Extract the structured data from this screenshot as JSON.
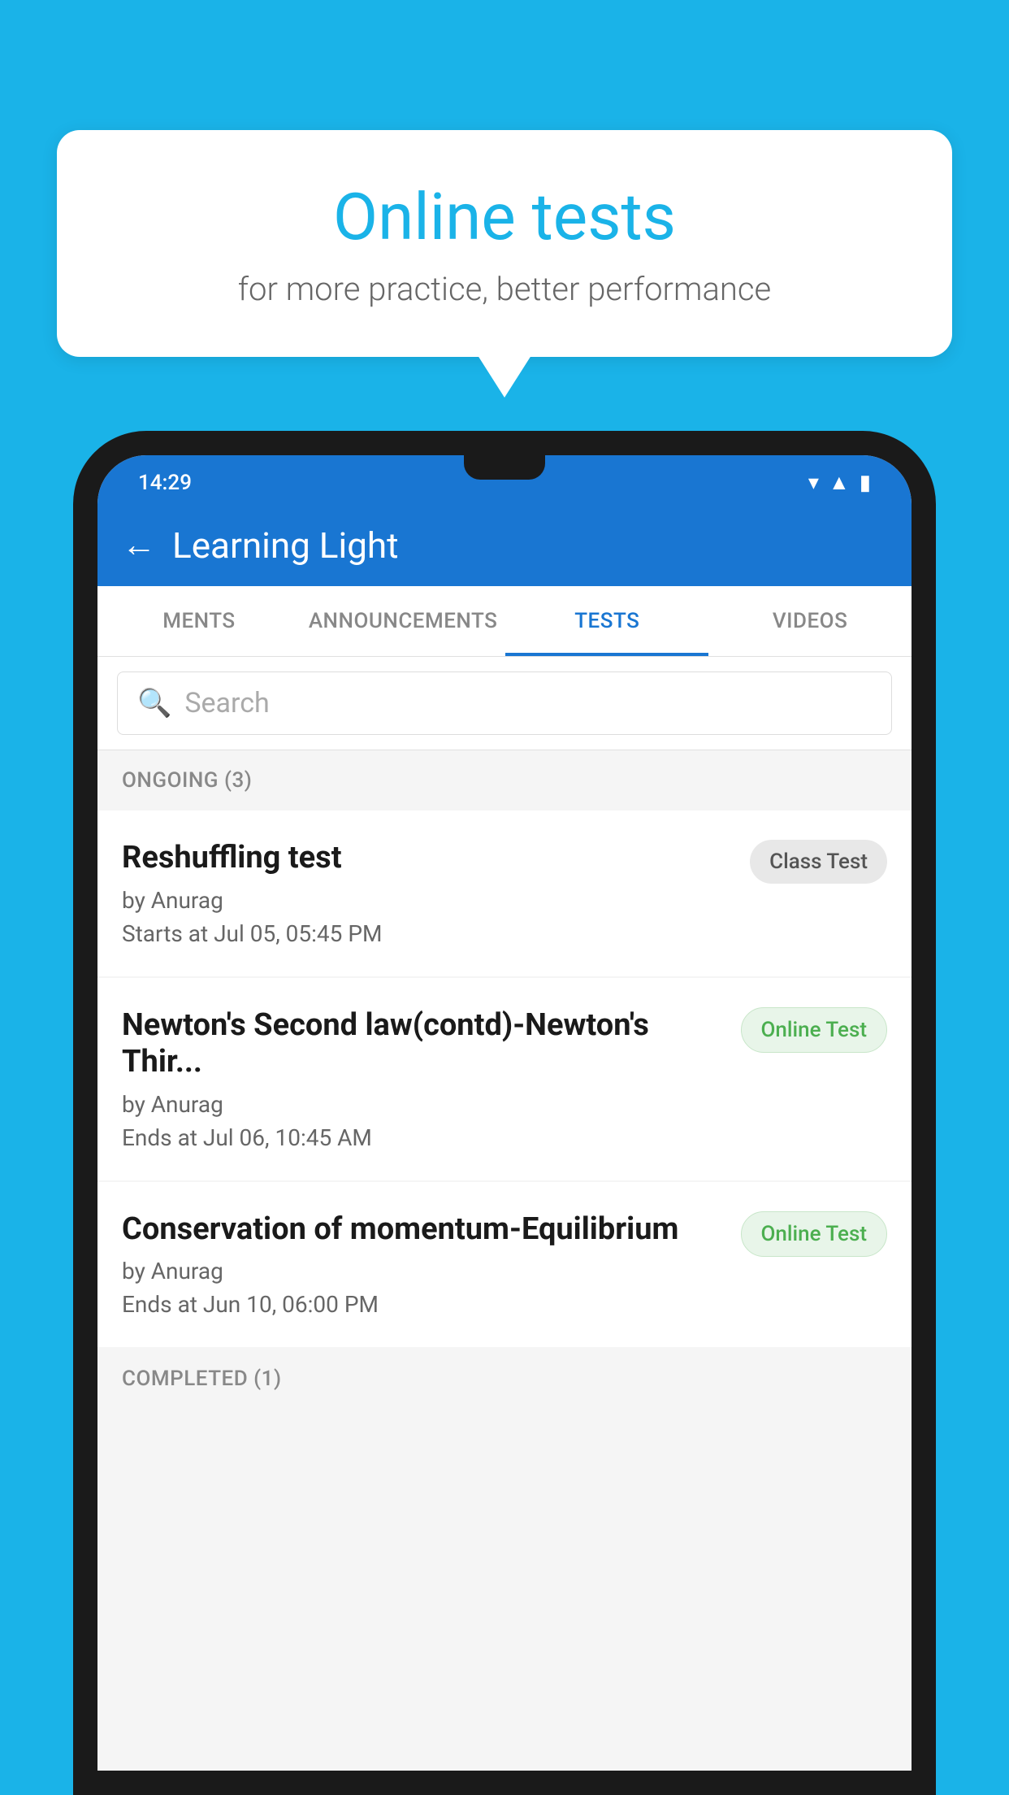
{
  "background": {
    "color": "#1ab3e8"
  },
  "speech_bubble": {
    "title": "Online tests",
    "subtitle": "for more practice, better performance"
  },
  "phone": {
    "status_bar": {
      "time": "14:29",
      "icons": [
        "wifi",
        "signal",
        "battery"
      ]
    },
    "header": {
      "back_label": "←",
      "title": "Learning Light"
    },
    "tabs": [
      {
        "label": "MENTS",
        "active": false
      },
      {
        "label": "ANNOUNCEMENTS",
        "active": false
      },
      {
        "label": "TESTS",
        "active": true
      },
      {
        "label": "VIDEOS",
        "active": false
      }
    ],
    "search": {
      "placeholder": "Search"
    },
    "ongoing_section": {
      "label": "ONGOING (3)"
    },
    "test_items": [
      {
        "name": "Reshuffling test",
        "by": "by Anurag",
        "date_label": "Starts at",
        "date": "Jul 05, 05:45 PM",
        "badge": "Class Test",
        "badge_type": "class"
      },
      {
        "name": "Newton's Second law(contd)-Newton's Thir...",
        "by": "by Anurag",
        "date_label": "Ends at",
        "date": "Jul 06, 10:45 AM",
        "badge": "Online Test",
        "badge_type": "online"
      },
      {
        "name": "Conservation of momentum-Equilibrium",
        "by": "by Anurag",
        "date_label": "Ends at",
        "date": "Jun 10, 06:00 PM",
        "badge": "Online Test",
        "badge_type": "online"
      }
    ],
    "completed_section": {
      "label": "COMPLETED (1)"
    }
  }
}
